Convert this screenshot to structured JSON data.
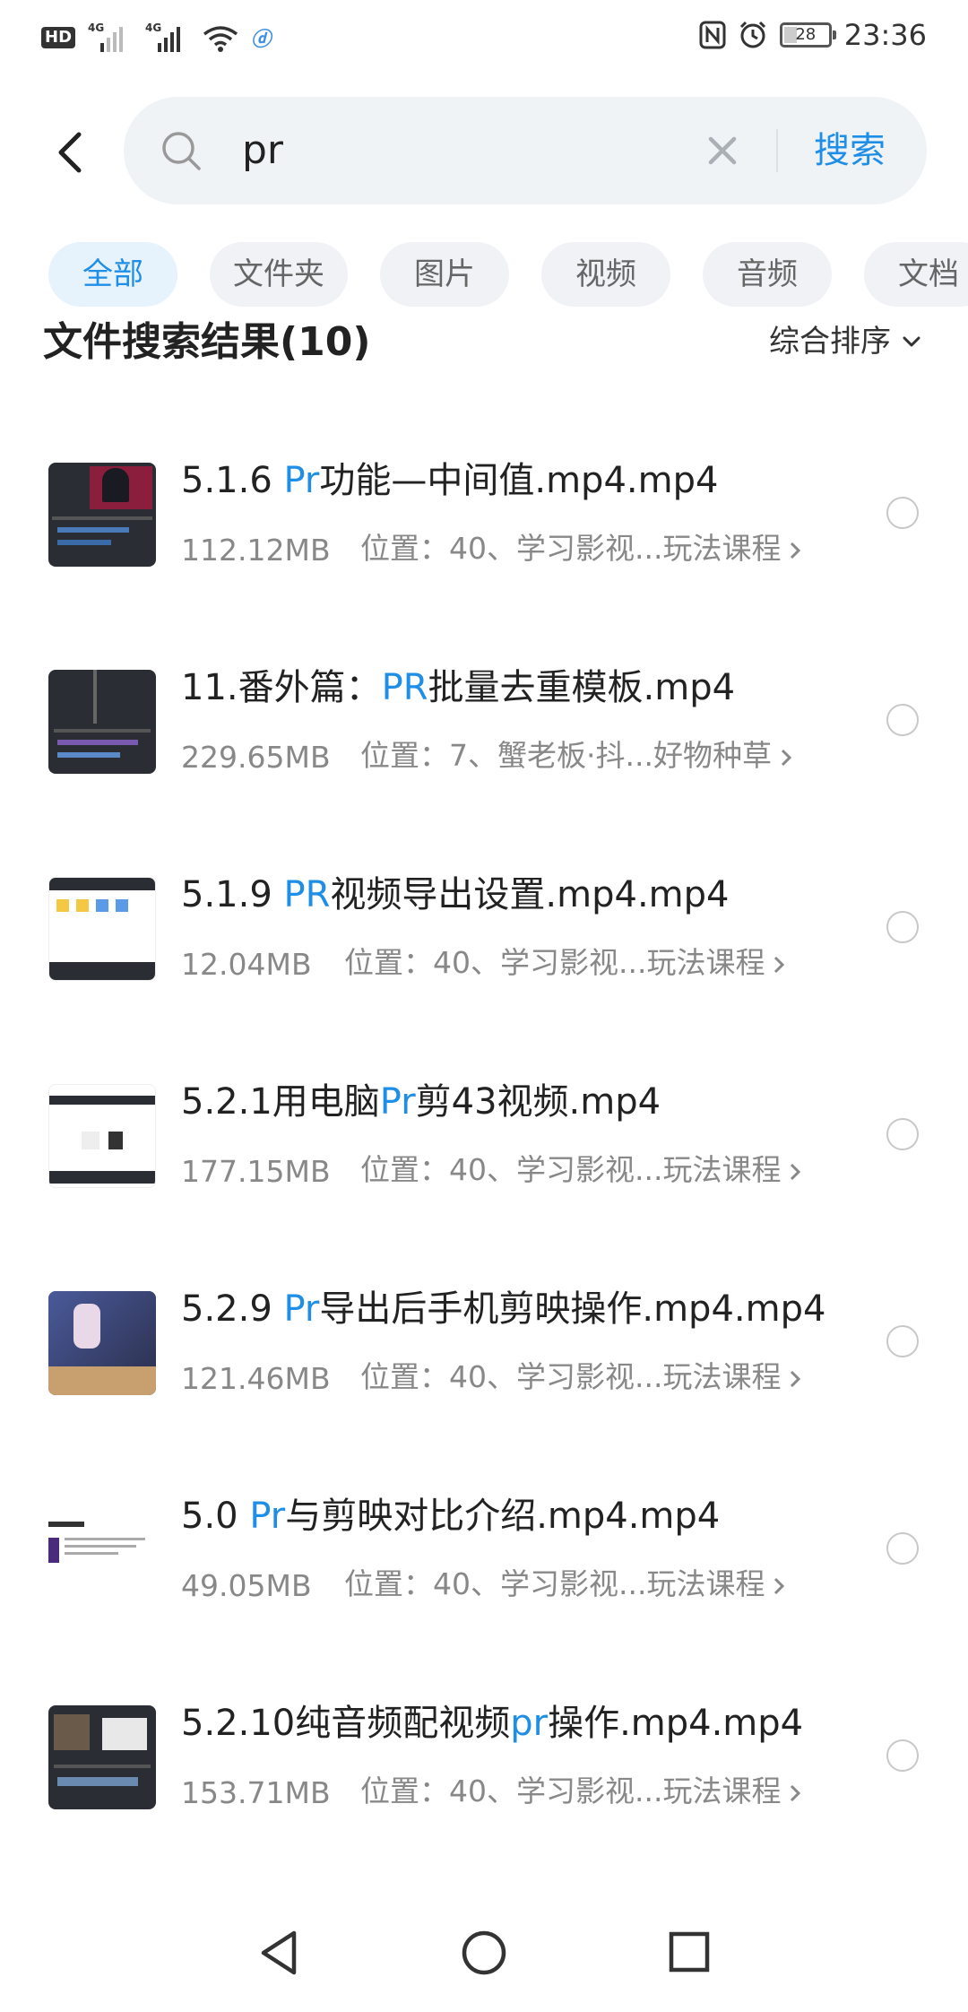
{
  "status_bar": {
    "hd": "HD",
    "net1": "4G",
    "net2": "4G",
    "battery": "28",
    "time": "23:36"
  },
  "search": {
    "query": "pr",
    "button_label": "搜索"
  },
  "filters": [
    "全部",
    "文件夹",
    "图片",
    "视频",
    "音频",
    "文档"
  ],
  "results": {
    "title": "文件搜索结果(10)",
    "sort_label": "综合排序"
  },
  "files": [
    {
      "pre": "5.1.6 ",
      "hl": "Pr",
      "post": "功能—中间值.mp4.mp4",
      "size": "112.12MB",
      "location": "位置：40、学习影视...玩法课程"
    },
    {
      "pre": "11.番外篇：",
      "hl": "PR",
      "post": "批量去重模板.mp4",
      "size": "229.65MB",
      "location": "位置：7、蟹老板·抖...好物种草"
    },
    {
      "pre": "5.1.9 ",
      "hl": "PR",
      "post": "视频导出设置.mp4.mp4",
      "size": "12.04MB",
      "location": "位置：40、学习影视...玩法课程"
    },
    {
      "pre": "5.2.1用电脑",
      "hl": "Pr",
      "post": "剪43视频.mp4",
      "size": "177.15MB",
      "location": "位置：40、学习影视...玩法课程"
    },
    {
      "pre": "5.2.9 ",
      "hl": "Pr",
      "post": "导出后手机剪映操作.mp4.mp4",
      "size": "121.46MB",
      "location": "位置：40、学习影视...玩法课程"
    },
    {
      "pre": "5.0 ",
      "hl": "Pr",
      "post": "与剪映对比介绍.mp4.mp4",
      "size": "49.05MB",
      "location": "位置：40、学习影视...玩法课程"
    },
    {
      "pre": "5.2.10纯音频配视频",
      "hl": "pr",
      "post": "操作.mp4.mp4",
      "size": "153.71MB",
      "location": "位置：40、学习影视...玩法课程"
    }
  ],
  "colors": {
    "accent": "#1e8ee6",
    "chip_active_bg": "#e6f2fc",
    "chip_bg": "#f0f2f5",
    "search_bg": "#f0f3f6"
  },
  "icons": [
    "back-arrow-icon",
    "search-icon",
    "clear-icon",
    "chevron-down-icon",
    "chevron-right-icon",
    "radio-icon",
    "nav-back-icon",
    "nav-home-icon",
    "nav-recent-icon"
  ]
}
